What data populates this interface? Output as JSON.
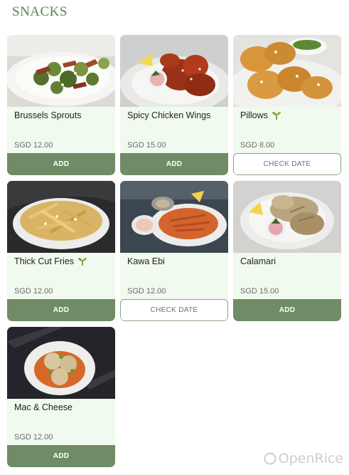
{
  "section": {
    "title": "SNACKS"
  },
  "items": [
    {
      "name": "Brussels Sprouts",
      "veg": false,
      "price": "SGD 12.00",
      "action": "ADD"
    },
    {
      "name": "Spicy Chicken Wings",
      "veg": false,
      "price": "SGD 15.00",
      "action": "ADD"
    },
    {
      "name": "Pillows",
      "veg": true,
      "price": "SGD 8.00",
      "action": "CHECK DATE"
    },
    {
      "name": "Thick Cut Fries",
      "veg": true,
      "price": "SGD 12.00",
      "action": "ADD"
    },
    {
      "name": "Kawa Ebi",
      "veg": false,
      "price": "SGD 12.00",
      "action": "CHECK DATE"
    },
    {
      "name": "Calamari",
      "veg": false,
      "price": "SGD 15.00",
      "action": "ADD"
    },
    {
      "name": "Mac & Cheese",
      "veg": false,
      "price": "SGD 12.00",
      "action": "ADD"
    }
  ],
  "watermark": {
    "brand": "OpenRice"
  },
  "colors": {
    "accent": "#6f8c66",
    "card_bg": "#f1faee",
    "title": "#5f7f58",
    "veg_leaf": "#7a9a3a"
  },
  "icons": {
    "veg": "vegetarian-leaf-icon"
  }
}
